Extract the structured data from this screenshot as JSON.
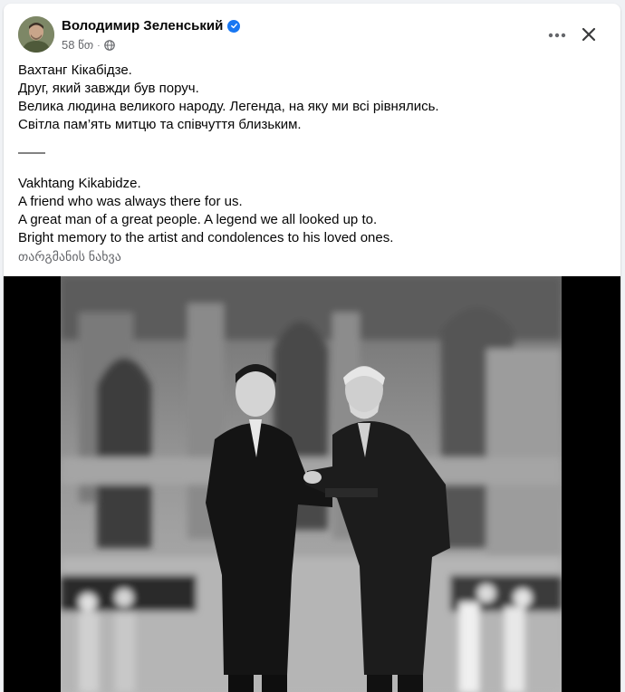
{
  "post": {
    "author": "Володимир Зеленський",
    "timestamp": "58 წთ",
    "lines_ua": [
      "Вахтанг Кікабідзе.",
      "Друг, який завжди був поруч.",
      "Велика людина великого народу. Легенда, на яку ми всі рівнялись.",
      "Світла пам’ять митцю та співчуття близьким."
    ],
    "separator": "——",
    "lines_en": [
      "Vakhtang Kikabidze.",
      "A friend who was always there for us.",
      "A great man of a great people. A legend we all looked up to.",
      "Bright memory to the artist and condolences to his loved ones."
    ],
    "translate_label": "თარგმანის ნახვა"
  },
  "icons": {
    "verified": "verified-badge-icon",
    "privacy": "globe-icon",
    "more": "more-options-icon",
    "close": "close-icon"
  },
  "colors": {
    "background": "#f0f2f5",
    "card": "#ffffff",
    "primary_text": "#050505",
    "secondary_text": "#65676b",
    "verified_blue": "#1877f2",
    "photo_letterbox": "#000000"
  }
}
